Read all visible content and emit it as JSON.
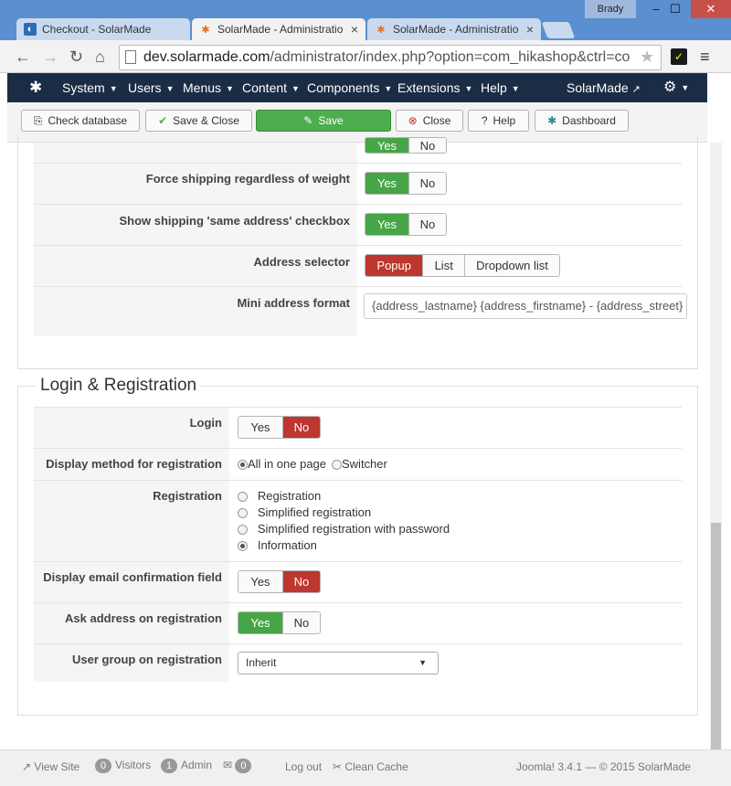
{
  "browser": {
    "user": "Brady",
    "tabs": [
      {
        "title": "Checkout - SolarMade",
        "active": false
      },
      {
        "title": "SolarMade - Administratio",
        "active": true
      },
      {
        "title": "SolarMade - Administratio",
        "active": false
      }
    ],
    "url_host": "dev.solarmade.com",
    "url_path": "/administrator/index.php?option=com_hikashop&ctrl=co"
  },
  "admin_menu": {
    "items": [
      "System",
      "Users",
      "Menus",
      "Content",
      "Components",
      "Extensions",
      "Help"
    ],
    "site_name": "SolarMade"
  },
  "toolbar": {
    "check_database": "Check database",
    "save_close": "Save & Close",
    "save": "Save",
    "close": "Close",
    "help": "Help",
    "dashboard": "Dashboard"
  },
  "shipping_section": {
    "partial_row": {
      "yes": "Yes",
      "no": "No"
    },
    "force_shipping": {
      "label": "Force shipping regardless of weight",
      "yes": "Yes",
      "no": "No",
      "value": "Yes"
    },
    "same_address": {
      "label": "Show shipping 'same address' checkbox",
      "yes": "Yes",
      "no": "No",
      "value": "Yes"
    },
    "address_selector": {
      "label": "Address selector",
      "options": [
        "Popup",
        "List",
        "Dropdown list"
      ],
      "value": "Popup"
    },
    "mini_address": {
      "label": "Mini address format",
      "value": "{address_lastname} {address_firstname} - {address_street}"
    }
  },
  "login_section": {
    "title": "Login & Registration",
    "login": {
      "label": "Login",
      "yes": "Yes",
      "no": "No",
      "value": "No"
    },
    "display_method": {
      "label": "Display method for registration",
      "options": [
        "All in one page",
        "Switcher"
      ],
      "value": "All in one page"
    },
    "registration": {
      "label": "Registration",
      "options": [
        "Registration",
        "Simplified registration",
        "Simplified registration with password",
        "Information"
      ],
      "value": "Information"
    },
    "email_confirm": {
      "label": "Display email confirmation field",
      "yes": "Yes",
      "no": "No",
      "value": "No"
    },
    "ask_address": {
      "label": "Ask address on registration",
      "yes": "Yes",
      "no": "No",
      "value": "Yes"
    },
    "user_group": {
      "label": "User group on registration",
      "value": "Inherit"
    }
  },
  "footer": {
    "view_site": "View Site",
    "visitors_count": "0",
    "visitors": "Visitors",
    "admin_count": "1",
    "admin": "Admin",
    "messages_count": "0",
    "logout": "Log out",
    "clean_cache": "Clean Cache",
    "version": "Joomla! 3.4.1  —  © 2015 SolarMade"
  }
}
